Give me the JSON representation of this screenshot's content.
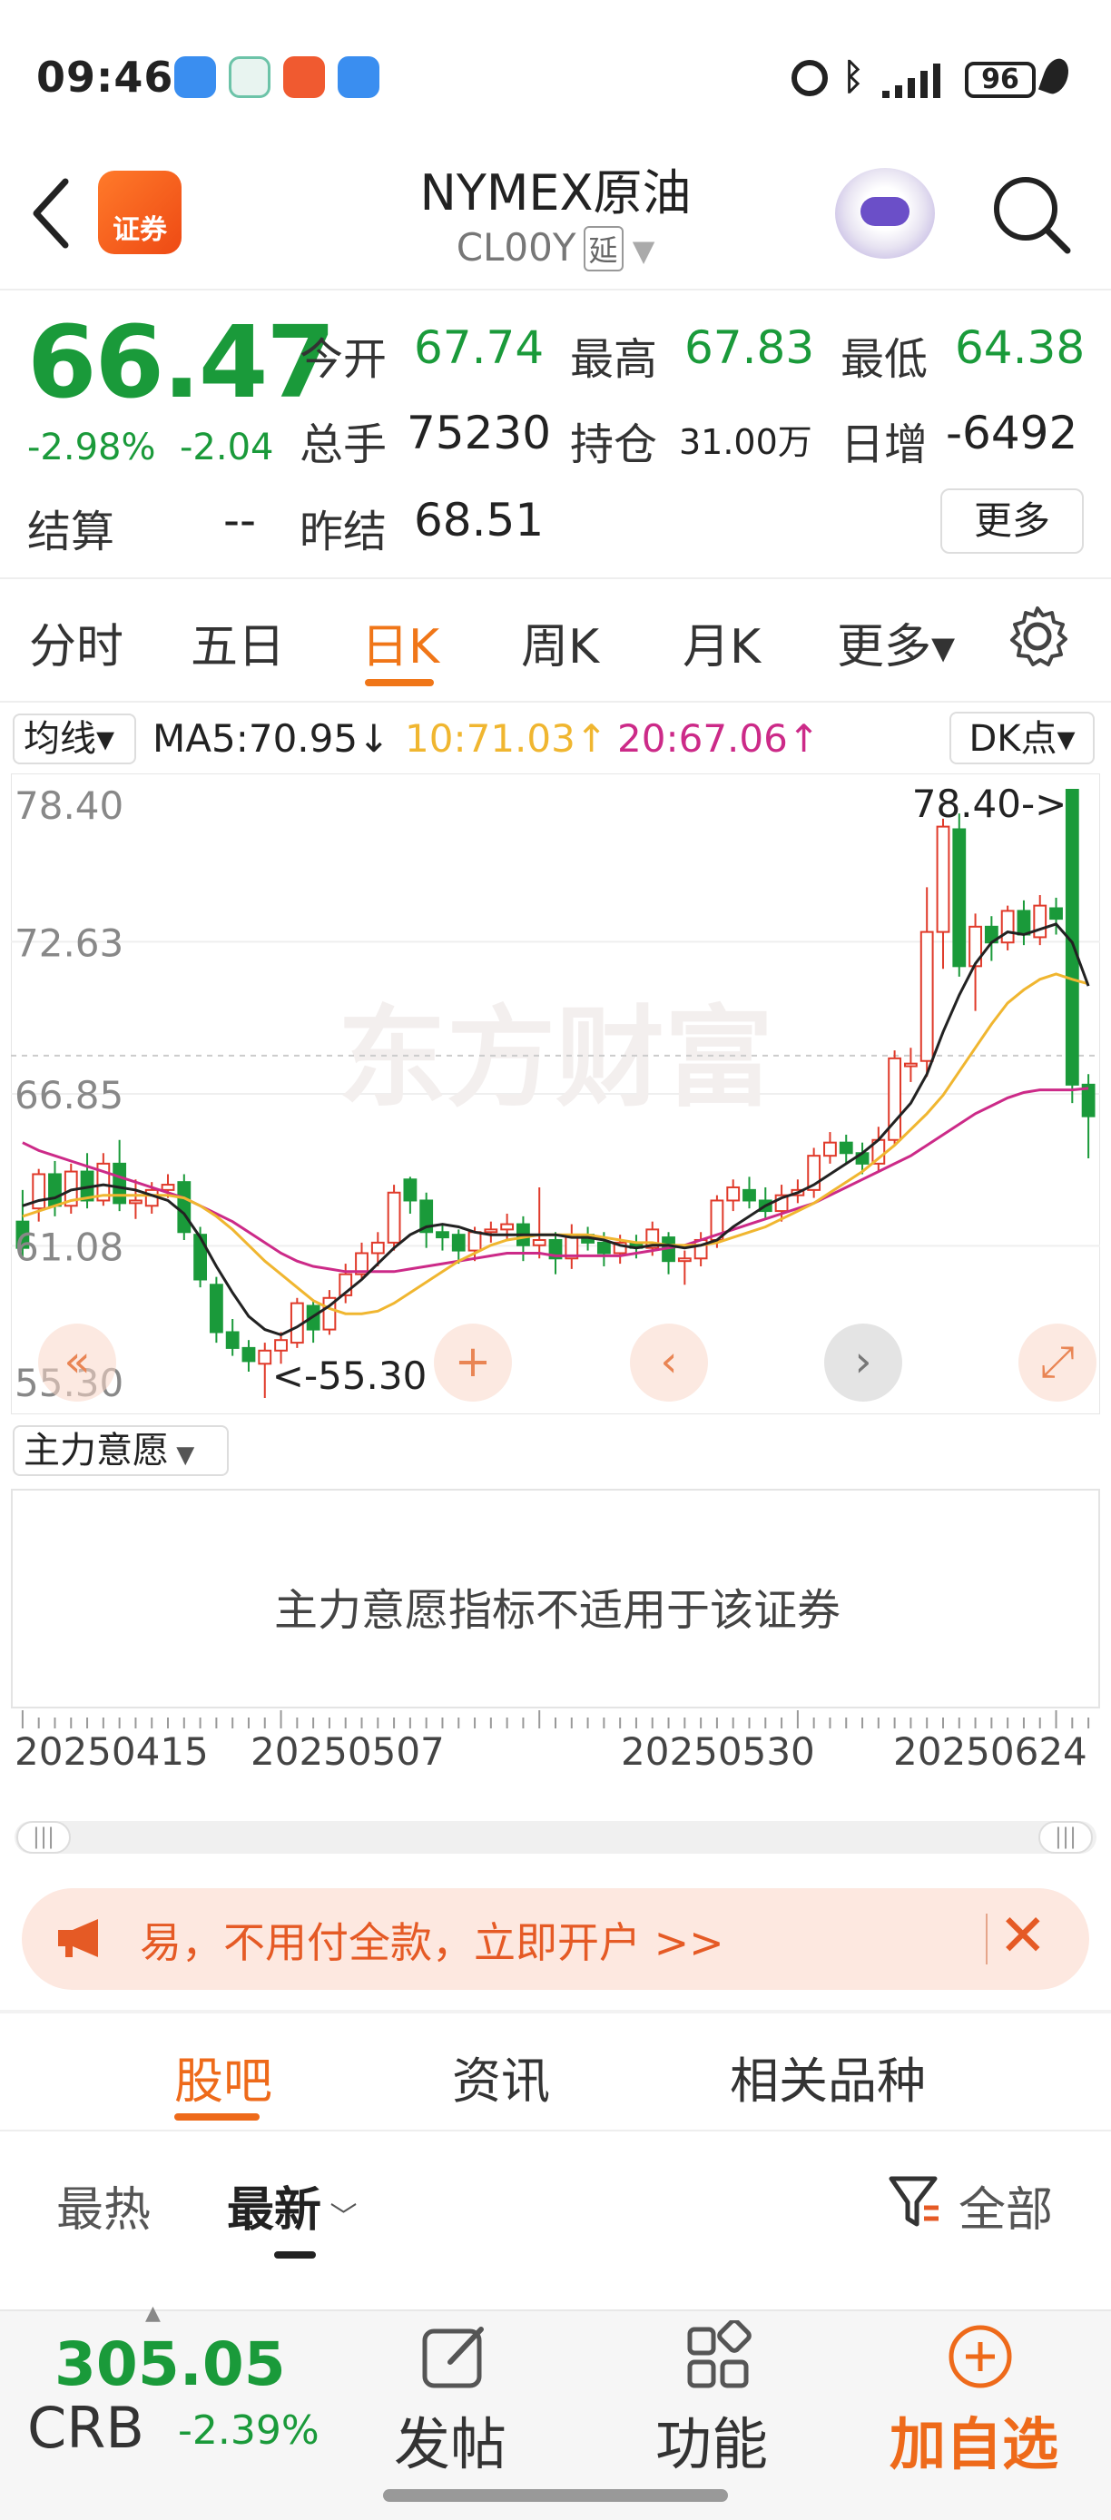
{
  "status_bar": {
    "time": "09:46",
    "battery": "96"
  },
  "header": {
    "title": "NYMEX原油",
    "code": "CL00Y",
    "delay_tag": "延",
    "logo_text": "证券"
  },
  "quote": {
    "price": "66.47",
    "change_pct": "-2.98%",
    "change": "-2.04",
    "open_label": "今开",
    "open": "67.74",
    "high_label": "最高",
    "high": "67.83",
    "low_label": "最低",
    "low": "64.38",
    "volume_label": "总手",
    "volume": "75230",
    "oi_label": "持仓",
    "oi": "31.00万",
    "daily_inc_label": "日增",
    "daily_inc": "-6492",
    "settle_label": "结算",
    "settle": "--",
    "prev_settle_label": "昨结",
    "prev_settle": "68.51",
    "more_label": "更多"
  },
  "tabs": [
    {
      "label": "分时"
    },
    {
      "label": "五日"
    },
    {
      "label": "日K"
    },
    {
      "label": "周K"
    },
    {
      "label": "月K"
    },
    {
      "label": "更多▾"
    }
  ],
  "ma_row": {
    "selector": "均线▾",
    "ma5": "MA5:70.95↓",
    "ma10": "10:71.03↑",
    "ma20": "20:67.06↑",
    "dk": "DK点▾"
  },
  "colors": {
    "up": "#e03a2a",
    "down": "#1a9a3a",
    "accent": "#f07618",
    "ma5": "#222222",
    "ma10": "#f0b630",
    "ma20": "#cc2a88"
  },
  "chart_data": {
    "type": "candlestick",
    "ylabels": [
      "78.40",
      "72.63",
      "66.85",
      "61.08",
      "55.30"
    ],
    "ylim": [
      55.3,
      78.4
    ],
    "max_marker": "78.40->",
    "min_marker": "<-55.30",
    "watermark": "东方财富",
    "xlabels": [
      "20250415",
      "20250507",
      "20250530",
      "20250624"
    ],
    "candles": [
      [
        62.0,
        61.0,
        63.2,
        60.6
      ],
      [
        62.5,
        63.8,
        64.0,
        62.0
      ],
      [
        63.8,
        62.6,
        64.3,
        62.2
      ],
      [
        62.6,
        63.9,
        64.2,
        62.3
      ],
      [
        63.9,
        62.8,
        64.6,
        62.5
      ],
      [
        62.8,
        64.2,
        64.6,
        62.6
      ],
      [
        64.2,
        62.7,
        65.1,
        62.4
      ],
      [
        62.7,
        62.8,
        63.6,
        62.1
      ],
      [
        62.6,
        63.2,
        63.5,
        62.3
      ],
      [
        63.2,
        63.4,
        63.8,
        62.9
      ],
      [
        63.5,
        61.6,
        63.8,
        61.3
      ],
      [
        61.5,
        59.8,
        61.8,
        59.5
      ],
      [
        59.6,
        57.8,
        59.9,
        57.4
      ],
      [
        57.8,
        57.2,
        58.3,
        56.9
      ],
      [
        57.2,
        56.7,
        57.5,
        56.3
      ],
      [
        56.6,
        57.1,
        57.4,
        55.3
      ],
      [
        57.1,
        57.5,
        57.8,
        56.6
      ],
      [
        57.4,
        58.9,
        59.1,
        57.2
      ],
      [
        58.8,
        57.9,
        59.0,
        57.4
      ],
      [
        57.9,
        59.1,
        59.4,
        57.7
      ],
      [
        59.2,
        60.0,
        60.4,
        58.9
      ],
      [
        60.0,
        60.8,
        61.2,
        59.8
      ],
      [
        60.8,
        61.2,
        61.6,
        60.3
      ],
      [
        61.2,
        63.1,
        63.4,
        60.9
      ],
      [
        63.6,
        62.8,
        63.7,
        62.3
      ],
      [
        62.8,
        61.6,
        63.1,
        61.0
      ],
      [
        61.6,
        61.4,
        61.9,
        60.9
      ],
      [
        61.5,
        60.9,
        61.7,
        60.4
      ],
      [
        60.9,
        61.6,
        61.8,
        60.5
      ],
      [
        61.6,
        61.7,
        62.0,
        61.2
      ],
      [
        61.7,
        61.9,
        62.3,
        61.3
      ],
      [
        61.9,
        61.1,
        62.2,
        60.5
      ],
      [
        61.1,
        61.3,
        63.3,
        60.6
      ],
      [
        61.3,
        60.6,
        61.6,
        60.0
      ],
      [
        60.6,
        61.5,
        61.9,
        60.2
      ],
      [
        61.5,
        61.2,
        61.8,
        60.9
      ],
      [
        61.2,
        60.8,
        61.6,
        60.3
      ],
      [
        60.8,
        61.2,
        61.5,
        60.4
      ],
      [
        61.2,
        61.0,
        61.5,
        60.6
      ],
      [
        61.0,
        61.7,
        62.0,
        60.7
      ],
      [
        61.4,
        60.5,
        61.6,
        60.0
      ],
      [
        60.5,
        60.6,
        60.9,
        59.6
      ],
      [
        60.6,
        61.3,
        61.6,
        60.3
      ],
      [
        61.3,
        62.8,
        63.0,
        61.0
      ],
      [
        62.8,
        63.3,
        63.6,
        62.4
      ],
      [
        63.2,
        62.8,
        63.7,
        62.5
      ],
      [
        62.8,
        62.4,
        63.3,
        62.1
      ],
      [
        62.4,
        63.0,
        63.4,
        62.0
      ],
      [
        63.0,
        63.2,
        63.6,
        62.7
      ],
      [
        63.2,
        64.5,
        64.8,
        62.9
      ],
      [
        64.5,
        65.0,
        65.4,
        64.2
      ],
      [
        65.0,
        64.6,
        65.3,
        64.2
      ],
      [
        64.6,
        64.2,
        65.0,
        63.8
      ],
      [
        64.2,
        65.1,
        65.6,
        63.9
      ],
      [
        65.1,
        68.2,
        68.5,
        64.9
      ],
      [
        67.9,
        68.0,
        68.6,
        67.3
      ],
      [
        68.1,
        73.0,
        74.7,
        67.5
      ],
      [
        73.0,
        77.0,
        77.3,
        71.6
      ],
      [
        76.9,
        71.7,
        77.5,
        71.3
      ],
      [
        71.7,
        73.2,
        73.7,
        70.0
      ],
      [
        73.2,
        72.6,
        73.6,
        71.9
      ],
      [
        72.6,
        73.8,
        74.0,
        72.3
      ],
      [
        73.8,
        72.9,
        74.2,
        72.5
      ],
      [
        72.8,
        74.0,
        74.4,
        72.5
      ],
      [
        73.9,
        73.5,
        74.3,
        72.9
      ],
      [
        78.4,
        67.2,
        78.4,
        66.5
      ],
      [
        67.2,
        66.0,
        67.6,
        64.4
      ]
    ],
    "ma5": [
      62.6,
      62.8,
      62.9,
      63.2,
      63.3,
      63.4,
      63.3,
      63.2,
      63.0,
      62.8,
      62.3,
      61.4,
      60.3,
      59.3,
      58.4,
      57.9,
      57.7,
      58.0,
      58.4,
      58.8,
      59.3,
      59.8,
      60.4,
      61.0,
      61.5,
      61.8,
      61.9,
      61.8,
      61.6,
      61.5,
      61.5,
      61.5,
      61.5,
      61.5,
      61.4,
      61.4,
      61.3,
      61.1,
      61.0,
      61.1,
      61.1,
      61.0,
      61.1,
      61.3,
      61.8,
      62.2,
      62.6,
      62.9,
      63.1,
      63.4,
      63.8,
      64.2,
      64.6,
      65.1,
      65.8,
      66.5,
      67.6,
      69.2,
      70.6,
      71.8,
      72.6,
      73.0,
      72.9,
      73.1,
      73.3,
      72.6,
      70.95
    ],
    "ma10": [
      62.2,
      62.4,
      62.6,
      62.8,
      62.9,
      63.0,
      63.0,
      63.0,
      63.0,
      63.0,
      62.9,
      62.6,
      62.2,
      61.7,
      61.1,
      60.5,
      60.0,
      59.5,
      59.0,
      58.7,
      58.5,
      58.5,
      58.6,
      58.9,
      59.3,
      59.7,
      60.1,
      60.5,
      60.8,
      61.1,
      61.3,
      61.4,
      61.5,
      61.5,
      61.5,
      61.5,
      61.4,
      61.3,
      61.2,
      61.2,
      61.1,
      61.1,
      61.1,
      61.2,
      61.4,
      61.6,
      61.8,
      62.1,
      62.4,
      62.7,
      63.1,
      63.5,
      63.9,
      64.4,
      64.9,
      65.5,
      66.1,
      66.8,
      67.7,
      68.6,
      69.5,
      70.3,
      70.8,
      71.2,
      71.4,
      71.2,
      71.03
    ],
    "ma20": [
      65.0,
      64.7,
      64.5,
      64.3,
      64.1,
      63.9,
      63.7,
      63.5,
      63.3,
      63.1,
      62.9,
      62.6,
      62.3,
      62.0,
      61.6,
      61.2,
      60.8,
      60.5,
      60.3,
      60.2,
      60.1,
      60.1,
      60.1,
      60.1,
      60.2,
      60.3,
      60.4,
      60.5,
      60.6,
      60.7,
      60.8,
      60.8,
      60.8,
      60.7,
      60.7,
      60.7,
      60.7,
      60.7,
      60.8,
      60.9,
      61.0,
      61.1,
      61.3,
      61.5,
      61.7,
      61.9,
      62.1,
      62.3,
      62.5,
      62.7,
      63.0,
      63.3,
      63.6,
      63.9,
      64.2,
      64.5,
      64.9,
      65.3,
      65.7,
      66.1,
      66.4,
      66.7,
      66.9,
      67.0,
      67.0,
      67.0,
      67.06
    ]
  },
  "indicator": {
    "selector": "主力意愿",
    "message": "主力意愿指标不适用于该证券"
  },
  "ad": {
    "text": "易，不用付全款，立即开户 >>"
  },
  "section_tabs": [
    {
      "label": "股吧"
    },
    {
      "label": "资讯"
    },
    {
      "label": "相关品种"
    }
  ],
  "sort": {
    "hot": "最热",
    "latest": "最新",
    "filter": "全部"
  },
  "bottom": {
    "index_value": "305.05",
    "index_name": "CRB",
    "index_change": "-2.39%",
    "post_label": "发帖",
    "func_label": "功能",
    "watch_label": "加自选"
  }
}
